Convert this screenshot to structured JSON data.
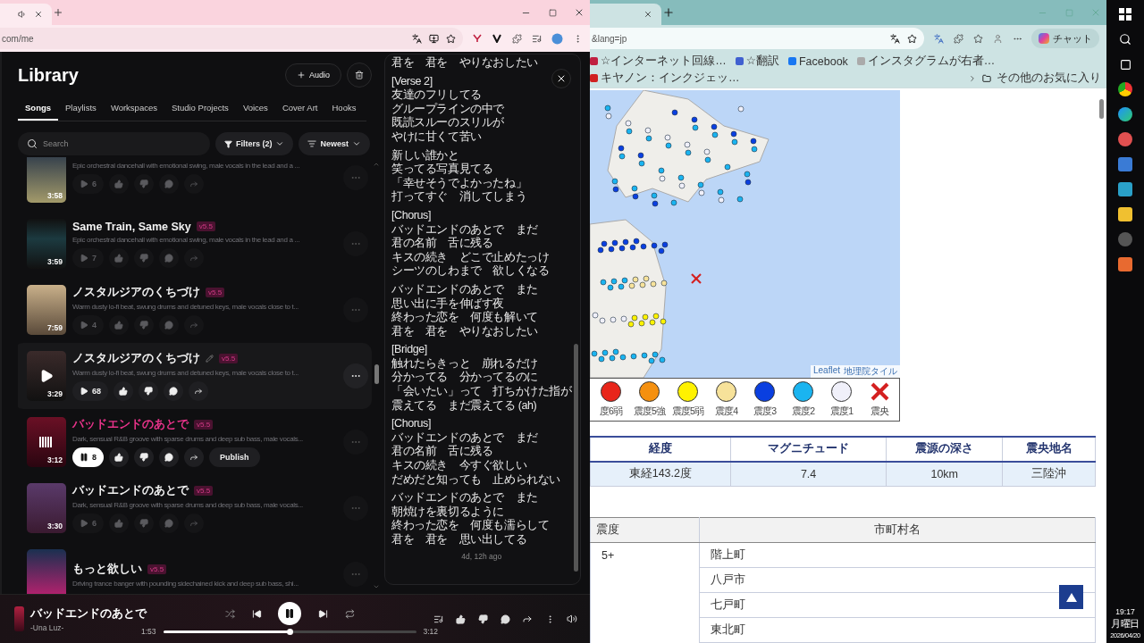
{
  "left_browser": {
    "address": "com/me"
  },
  "library": {
    "title": "Library",
    "audio_button": "Audio",
    "tabs": [
      {
        "label": "Songs",
        "selected": true
      },
      {
        "label": "Playlists",
        "selected": false
      },
      {
        "label": "Workspaces",
        "selected": false
      },
      {
        "label": "Studio Projects",
        "selected": false
      },
      {
        "label": "Voices",
        "selected": false
      },
      {
        "label": "Cover Art",
        "selected": false
      },
      {
        "label": "Hooks",
        "selected": false
      }
    ],
    "search": {
      "placeholder": "Search"
    },
    "filters_button": "Filters (2)",
    "sort_button": "Newest",
    "songs": [
      {
        "description": "Epic orchestral dancehall with emotional swing, male vocals in the lead and a ...",
        "duration": "3:58",
        "plays": "6",
        "playing": false,
        "hovered": false,
        "editable": false
      },
      {
        "title": "Same Train, Same Sky",
        "version": "v5.5",
        "description": "Epic orchestral dancehall with emotional swing, male vocals in the lead and a ...",
        "duration": "3:59",
        "plays": "7",
        "playing": false,
        "hovered": false,
        "editable": false
      },
      {
        "title": "ノスタルジアのくちづけ",
        "version": "v5.5",
        "description": "Warm dusty lo-fi beat, swung drums and detuned keys, male vocals close to t...",
        "duration": "7:59",
        "plays": "4",
        "playing": false,
        "hovered": false,
        "editable": false
      },
      {
        "title": "ノスタルジアのくちづけ",
        "version": "v5.5",
        "description": "Warm dusty lo-fi beat, swung drums and detuned keys, male vocals close to t...",
        "duration": "3:29",
        "plays": "68",
        "playing": false,
        "hovered": true,
        "editable": true
      },
      {
        "title": "バッドエンドのあとで",
        "version": "v5.5",
        "description": "Dark, sensual R&B groove with sparse drums and deep sub bass, male vocals...",
        "duration": "3:12",
        "plays": "8",
        "playing": true,
        "hovered": false,
        "editable": false,
        "publish_button": "Publish"
      },
      {
        "title": "バッドエンドのあとで",
        "version": "v5.5",
        "description": "Dark, sensual R&B groove with sparse drums and deep sub bass, male vocals...",
        "duration": "3:30",
        "plays": "6",
        "playing": false,
        "hovered": false,
        "editable": false
      },
      {
        "title": "もっと欲しい",
        "version": "v5.5",
        "description": "Driving trance banger with pounding sidechained kick and deep sub bass, shi...",
        "playing": false,
        "hovered": false,
        "editable": false
      }
    ]
  },
  "lyrics": {
    "stanzas": [
      [
        "君を　君を　やりなおしたい"
      ],
      [
        "[Verse 2]",
        "友達のフリしてる",
        "グループラインの中で",
        "既読スルーのスリルが",
        "やけに甘くて苦い"
      ],
      [
        "新しい誰かと",
        "笑ってる写真見てる",
        "「幸せそうでよかったね」",
        "打ってすぐ　消してしまう"
      ],
      [
        "[Chorus]",
        "バッドエンドのあとで　まだ",
        "君の名前　舌に残る",
        "キスの続き　どこで止めたっけ",
        "シーツのしわまで　欲しくなる"
      ],
      [
        "バッドエンドのあとで　また",
        "思い出に手を伸ばす夜",
        "終わった恋を　何度も解いて",
        "君を　君を　やりなおしたい"
      ],
      [
        "[Bridge]",
        "触れたらきっと　崩れるだけ",
        "分かってる　分かってるのに",
        "「会いたい」って　打ちかけた指が",
        "震えてる　まだ震えてる (ah)"
      ],
      [
        "[Chorus]",
        "バッドエンドのあとで　まだ",
        "君の名前　舌に残る",
        "キスの続き　今すぐ欲しい",
        "だめだと知っても　止められない"
      ],
      [
        "バッドエンドのあとで　また",
        "朝焼けを裏切るように",
        "終わった恋を　何度も濡らして",
        "君を　君を　思い出してる"
      ]
    ],
    "timestamp": "4d, 12h ago"
  },
  "player": {
    "title": "バッドエンドのあとで",
    "artist": "-Una Luz-",
    "elapsed": "1:53",
    "total": "3:12",
    "level": 0.5,
    "playing": true
  },
  "right_browser": {
    "address": "&lang=jp",
    "copilot_button": "チャット",
    "bookmarks": [
      "☆インターネット回線…",
      "☆翻訳",
      "Facebook",
      "インスタグラムが右者…",
      "キヤノン：インクジェッ…"
    ],
    "other_bookmarks": "その他のお気に入り"
  },
  "map": {
    "attribution": [
      "Leaflet",
      "地理院タイル"
    ]
  },
  "legend": [
    {
      "label": "度6弱",
      "color": "#e8251a",
      "kind": "circle"
    },
    {
      "label": "震度5強",
      "color": "#f5900f",
      "kind": "circle"
    },
    {
      "label": "震度5弱",
      "color": "#fff200",
      "kind": "circle"
    },
    {
      "label": "震度4",
      "color": "#f7e29a",
      "kind": "circle"
    },
    {
      "label": "震度3",
      "color": "#0a3fe0",
      "kind": "circle"
    },
    {
      "label": "震度2",
      "color": "#1ab4f0",
      "kind": "circle"
    },
    {
      "label": "震度1",
      "color": "#f0f0fa",
      "kind": "circle"
    },
    {
      "label": "震央",
      "color": "#d42020",
      "kind": "cross"
    }
  ],
  "summary_table": {
    "columns": [
      "経度",
      "マグニチュード",
      "震源の深さ",
      "震央地名"
    ],
    "rows": [
      [
        "東経143.2度",
        "7.4",
        "10km",
        "三陸沖"
      ]
    ]
  },
  "town_table": {
    "columns": [
      "震度",
      "市町村名"
    ],
    "rows": [
      {
        "intensity": "5+",
        "town": "階上町"
      },
      {
        "town": "八戸市"
      },
      {
        "town": "七戸町"
      },
      {
        "town": "東北町"
      }
    ]
  },
  "taskbar": {
    "time": "19:17",
    "day": "月曜日",
    "date": "2026/04/20"
  }
}
